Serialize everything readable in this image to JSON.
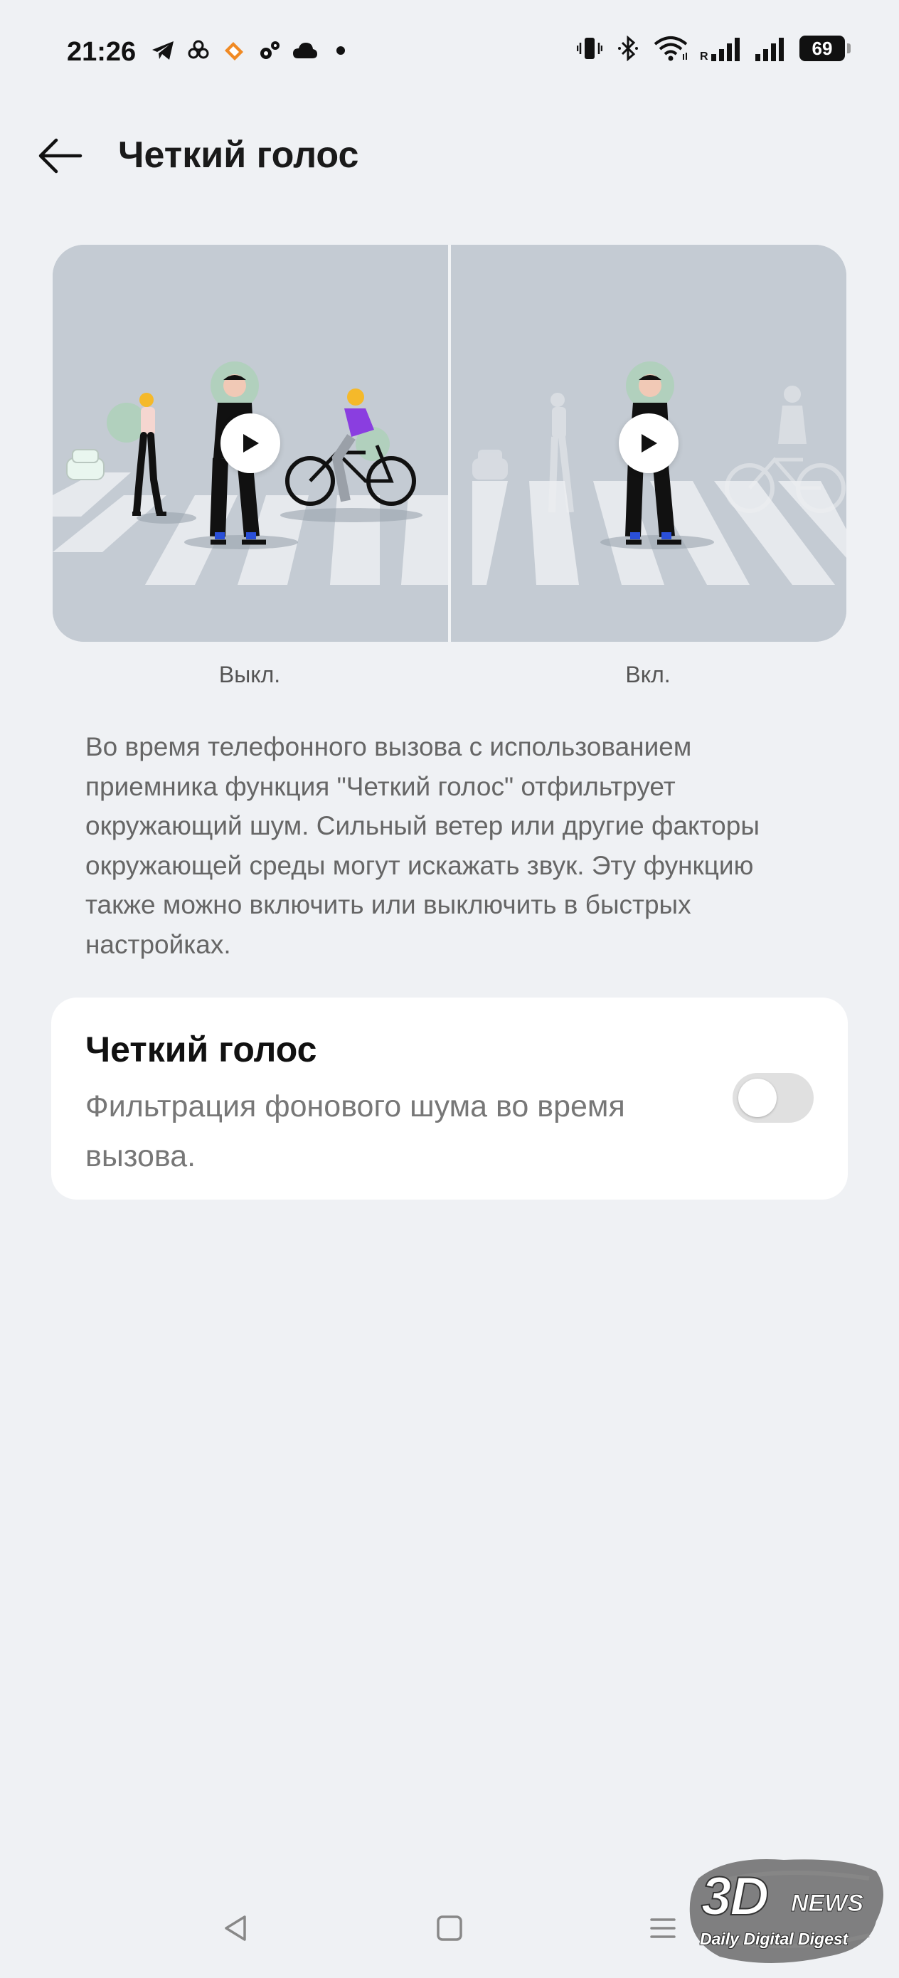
{
  "status_bar": {
    "time": "21:26",
    "battery": "69",
    "left_icons": [
      "telegram-icon",
      "pinwheel-icon",
      "stamp-icon",
      "gear-cluster-icon",
      "cloud-icon",
      "dot-icon"
    ],
    "right_icons": [
      "vibrate-icon",
      "bluetooth-icon",
      "wifi-icon",
      "signal-roaming-icon",
      "signal-icon",
      "battery-icon"
    ],
    "roaming_label": "R"
  },
  "header": {
    "title": "Четкий голос"
  },
  "illustration": {
    "off_label": "Выкл.",
    "on_label": "Вкл."
  },
  "description": "Во время телефонного вызова с использованием приемника функция \"Четкий голос\" отфильтрует окружающий шум. Сильный ветер или другие факторы окружающей среды могут искажать звук. Эту функцию также можно включить или выключить в быстрых настройках.",
  "setting": {
    "title": "Четкий голос",
    "subtitle": "Фильтрация фонового шума во время вызова.",
    "enabled": false
  },
  "watermark": {
    "logo": "3D",
    "news": "NEWS",
    "tagline": "Daily Digital Digest"
  },
  "colors": {
    "background": "#eff1f4",
    "card": "#ffffff",
    "illustration_bg": "#c4cbd3",
    "accent_purple": "#8a3ee0",
    "accent_yellow": "#f5b92a",
    "accent_blue": "#2a4fd8",
    "green_halo": "#9ed5a8"
  }
}
